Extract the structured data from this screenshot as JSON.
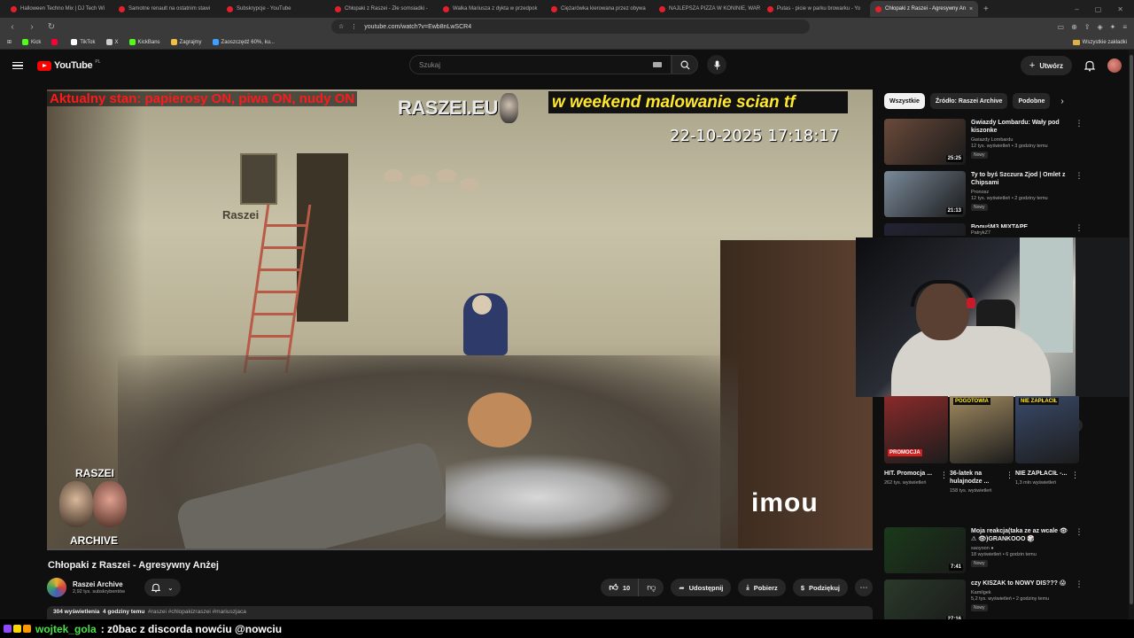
{
  "browser": {
    "tabs": [
      {
        "title": "Halloween Techno Mix | DJ Tech Wi"
      },
      {
        "title": "Samotne renault na ostatnim stawi"
      },
      {
        "title": "Subskrypcje - YouTube"
      },
      {
        "title": "Chłopaki z Raszei - Złe somsiadki - "
      },
      {
        "title": "Walka Mariusza z dykta w przedpok"
      },
      {
        "title": "Ciężarówka kierowana przez obywa"
      },
      {
        "title": "NAJLEPSZA PIZZA W KONINIE, WAR"
      },
      {
        "title": "Putas - picie w parku browarku - Yo"
      },
      {
        "title": "Chłopaki z Raszei - Agresywny An",
        "active": true
      }
    ],
    "url": "youtube.com/watch?v=Ewb8nLwSCR4",
    "bookmarks": [
      {
        "label": "Kick",
        "color": "#53fc18"
      },
      {
        "label": "",
        "color": "#ff0033"
      },
      {
        "label": "TikTok",
        "color": "#ffffff"
      },
      {
        "label": "X",
        "color": "#cccccc"
      },
      {
        "label": "KickBans",
        "color": "#53fc18"
      },
      {
        "label": "Zagrajmy",
        "color": "#f0c040"
      },
      {
        "label": "Zaoszczędź 60%, ku...",
        "color": "#40a0ff"
      }
    ],
    "bookmarks_right": "Wszystkie zakładki"
  },
  "youtube": {
    "logo_text": "YouTube",
    "logo_region": "PL",
    "search_placeholder": "Szukaj",
    "create_label": "Utwórz"
  },
  "player": {
    "overlay_top_left": "Aktualny stan: papierosy ON, piwa ON, nudy ON",
    "overlay_brand": "RASZEI.EU",
    "overlay_ticker": "w weekend malowanie scian tf",
    "overlay_timestamp": "22-10-2025 17:18:17",
    "overlay_camera_brand": "imou",
    "overlay_logo_top": "RASZEI",
    "overlay_logo_bottom": "ARCHIVE",
    "wall_sign": "Raszei"
  },
  "video": {
    "title": "Chłopaki z Raszei - Agresywny Anżej",
    "channel_name": "Raszei Archive",
    "channel_subs": "2,92 tys. subskrybentów",
    "likes": "10",
    "share_label": "Udostępnij",
    "download_label": "Pobierz",
    "thanks_label": "Podziękuj",
    "views": "304 wyświetlenia",
    "age": "4 godziny temu",
    "hashtags": "#raszei #chlopakizraszei #mariuszjaca"
  },
  "sidebar": {
    "chips": [
      "Wszystkie",
      "Źródło: Raszei Archive",
      "Podobne"
    ],
    "recommendations": [
      {
        "title": "Gwiazdy Lombardu: Wały pod kiszonke",
        "channel": "Gwiazdy Lombardu",
        "meta": "12 tys. wyświetleń • 3 godziny temu",
        "badge": "Nowy",
        "duration": "25:25",
        "color": "#6a4a3a"
      },
      {
        "title": "Ty to byś Szczura Zjod | Omlet z Chipsami",
        "channel": "Pronosz",
        "meta": "12 tys. wyświetleń • 2 godziny temu",
        "badge": "Nowy",
        "duration": "21:13",
        "color": "#7a8a9a"
      },
      {
        "title": "BoguśM3 MIXTAPE",
        "channel": "PatrykZ7",
        "meta": "",
        "badge": "",
        "duration": "",
        "color": "#223"
      }
    ],
    "shorts": [
      {
        "title": "HIT. Promocja ...",
        "views": "262 tys. wyświetleń",
        "label": "PROMOCJA",
        "color": "#8a2a2a"
      },
      {
        "title": "36-latek na hulajnodze ...",
        "views": "158 tys. wyświetleń",
        "label": "POGOTOWIA",
        "color": "#a08a60"
      },
      {
        "title": "NIE ZAPŁACIŁ -...",
        "views": "1,3 mln wyświetleń",
        "label": "NIE ZAPŁACIŁ",
        "color": "#3a4a6a"
      }
    ],
    "recommendations_2": [
      {
        "title": "Moja reakcja(taka ze az wcale 👁 ⚠ 👁)GRANKOOO 🎲",
        "channel": "saoyoon ●",
        "meta": "18 wyświetleń • 6 godzin temu",
        "badge": "Nowy",
        "duration": "7:41",
        "color": "#1a3a1a"
      },
      {
        "title": "czy KISZAK to NOWY DIS??? 😱",
        "channel": "Kamilgek",
        "meta": "5,2 tys. wyświetleń • 2 godziny temu",
        "badge": "Nowy",
        "duration": "27:16",
        "color": "#2a3a2a"
      }
    ]
  },
  "chat": {
    "username": "wojtek_gola",
    "message": ": z0bac z discorda nowćiu @nowciu",
    "badge_colors": [
      "#9147ff",
      "#ffd700",
      "#ff9900"
    ]
  },
  "colors": {
    "bg": "#0f0f0f",
    "accent": "#ff0000",
    "chat_user": "#4ae04a",
    "ticker": "#ffe82b"
  },
  "progress": {
    "played_fraction": 0.0
  }
}
